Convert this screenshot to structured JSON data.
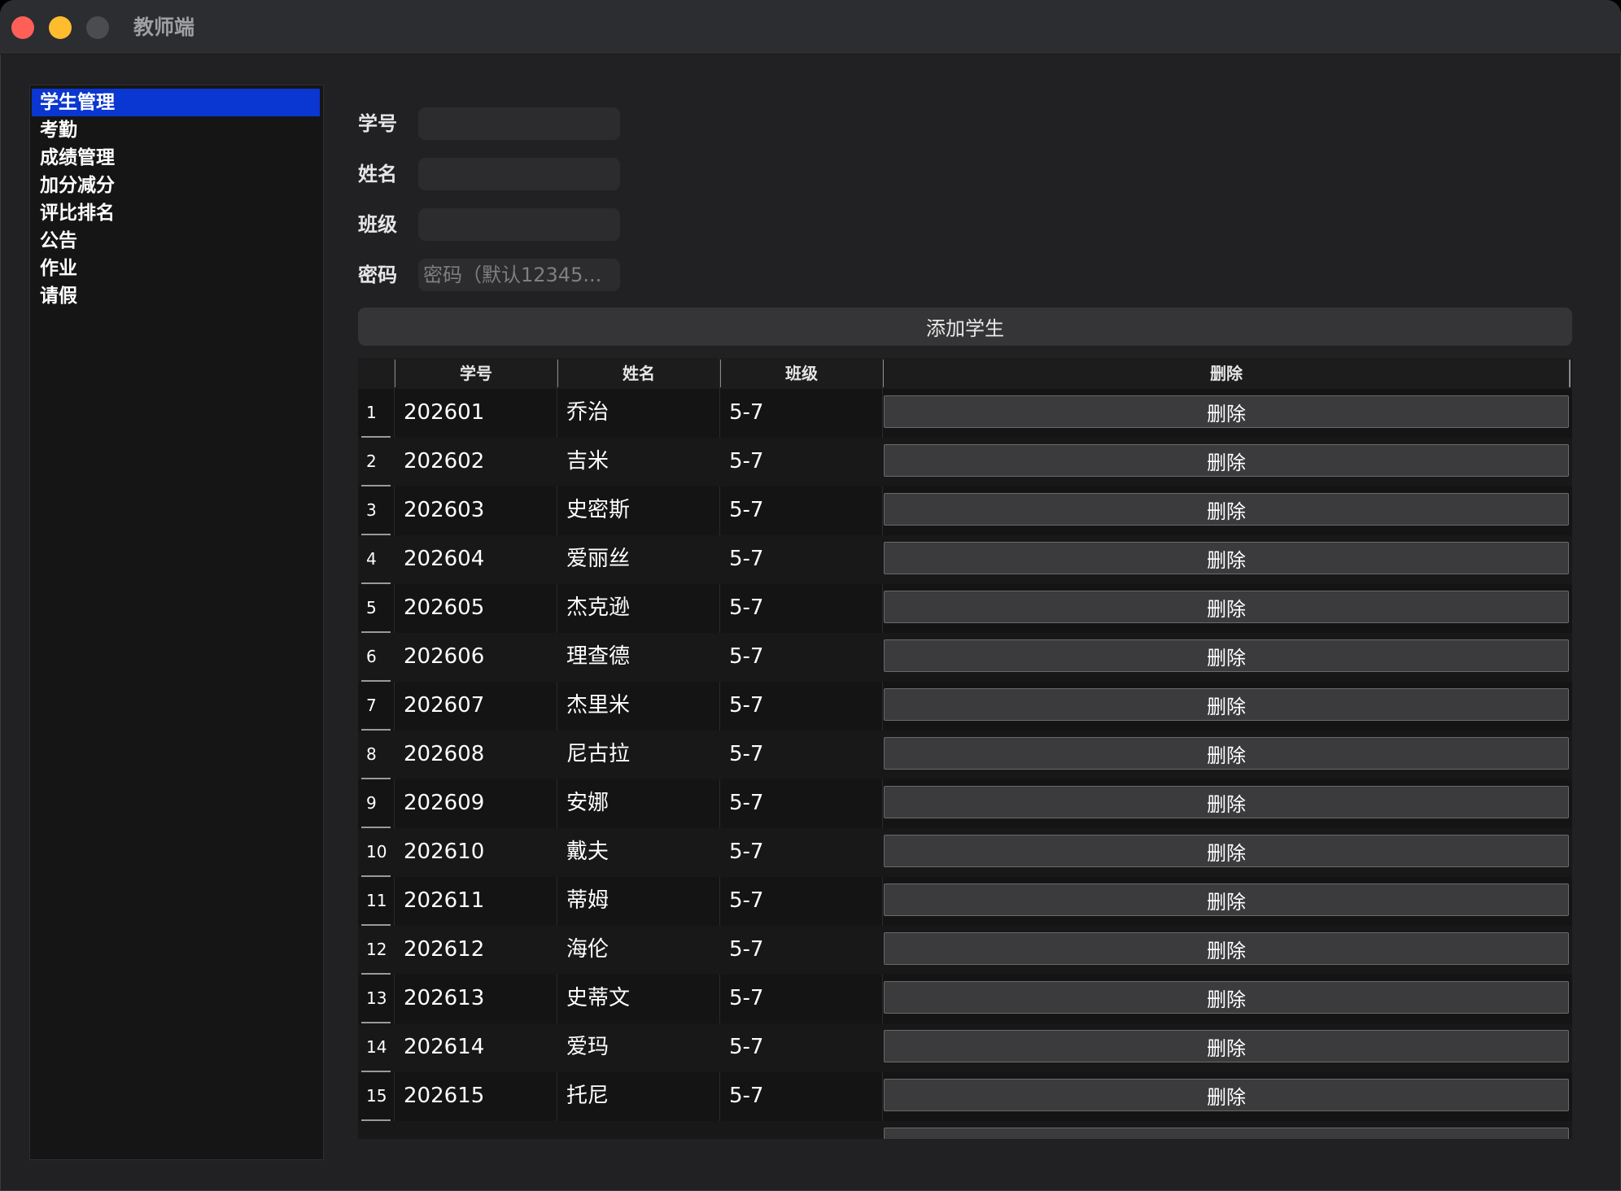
{
  "window": {
    "title": "教师端"
  },
  "sidebar": {
    "items": [
      {
        "label": "学生管理",
        "active": true
      },
      {
        "label": "考勤"
      },
      {
        "label": "成绩管理"
      },
      {
        "label": "加分减分"
      },
      {
        "label": "评比排名"
      },
      {
        "label": "公告"
      },
      {
        "label": "作业"
      },
      {
        "label": "请假"
      }
    ]
  },
  "form": {
    "student_id_label": "学号",
    "student_id_value": "",
    "name_label": "姓名",
    "name_value": "",
    "class_label": "班级",
    "class_value": "",
    "password_label": "密码",
    "password_placeholder": "密码（默认12345...",
    "add_button": "添加学生"
  },
  "table": {
    "headers": [
      "学号",
      "姓名",
      "班级",
      "删除"
    ],
    "delete_label": "删除",
    "rows": [
      {
        "no": "1",
        "id": "202601",
        "name": "乔治",
        "class": "5-7"
      },
      {
        "no": "2",
        "id": "202602",
        "name": "吉米",
        "class": "5-7"
      },
      {
        "no": "3",
        "id": "202603",
        "name": "史密斯",
        "class": "5-7"
      },
      {
        "no": "4",
        "id": "202604",
        "name": "爱丽丝",
        "class": "5-7"
      },
      {
        "no": "5",
        "id": "202605",
        "name": "杰克逊",
        "class": "5-7"
      },
      {
        "no": "6",
        "id": "202606",
        "name": "理查德",
        "class": "5-7"
      },
      {
        "no": "7",
        "id": "202607",
        "name": "杰里米",
        "class": "5-7"
      },
      {
        "no": "8",
        "id": "202608",
        "name": "尼古拉",
        "class": "5-7"
      },
      {
        "no": "9",
        "id": "202609",
        "name": "安娜",
        "class": "5-7"
      },
      {
        "no": "10",
        "id": "202610",
        "name": "戴夫",
        "class": "5-7"
      },
      {
        "no": "11",
        "id": "202611",
        "name": "蒂姆",
        "class": "5-7"
      },
      {
        "no": "12",
        "id": "202612",
        "name": "海伦",
        "class": "5-7"
      },
      {
        "no": "13",
        "id": "202613",
        "name": "史蒂文",
        "class": "5-7"
      },
      {
        "no": "14",
        "id": "202614",
        "name": "爱玛",
        "class": "5-7"
      },
      {
        "no": "15",
        "id": "202615",
        "name": "托尼",
        "class": "5-7"
      }
    ]
  }
}
